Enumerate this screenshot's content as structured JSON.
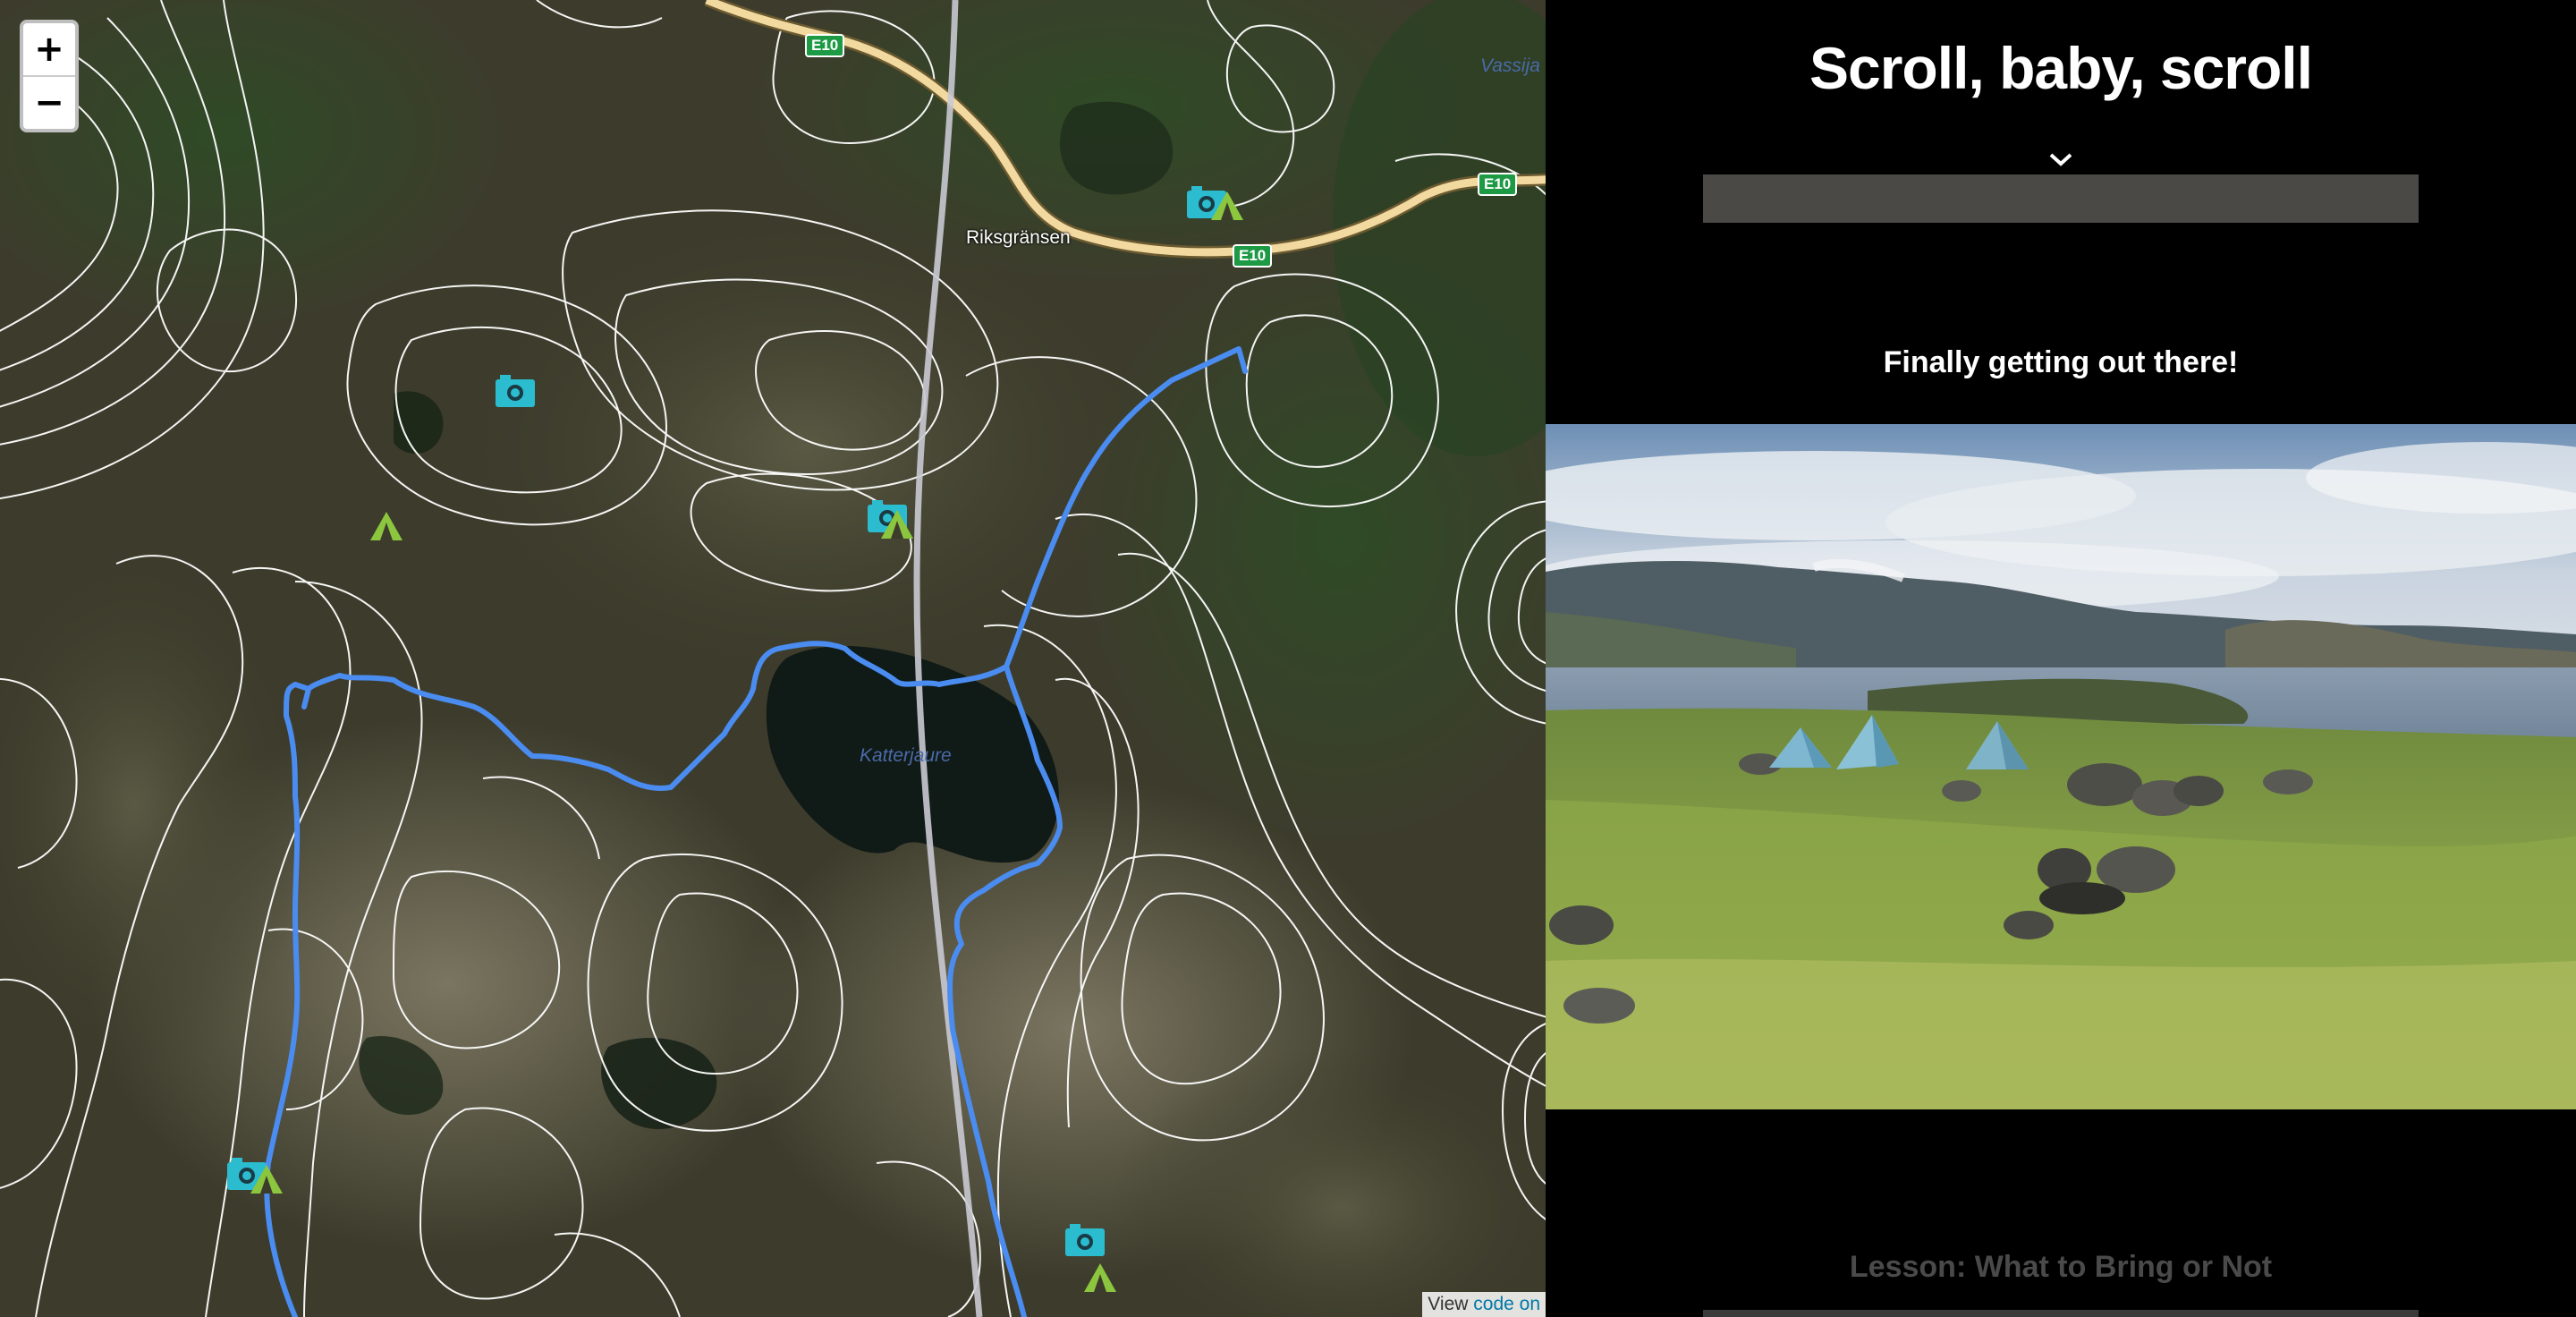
{
  "map": {
    "zoom_in_label": "+",
    "zoom_out_label": "−",
    "places": {
      "town": "Riksgränsen",
      "lake": "Katterjaure",
      "water_edge": "Vassija"
    },
    "road_shields": [
      "E10",
      "E10",
      "E10"
    ],
    "attribution": {
      "prefix": "View",
      "link_text": "code on"
    },
    "icons": {
      "photo_marker": "camera-icon",
      "camp_marker": "tent-icon"
    },
    "colors": {
      "route": "#4a8cf0",
      "road": "#f2d9a0",
      "shield": "#1e9a45",
      "camera": "#2bbccf",
      "tent": "#8cc63f"
    }
  },
  "panel": {
    "title": "Scroll, baby, scroll",
    "scroll_indicator": "chevron-down-icon",
    "sections": [
      {
        "heading": "Finally getting out there!"
      },
      {
        "heading": "Lesson: What to Bring or Not"
      }
    ]
  }
}
